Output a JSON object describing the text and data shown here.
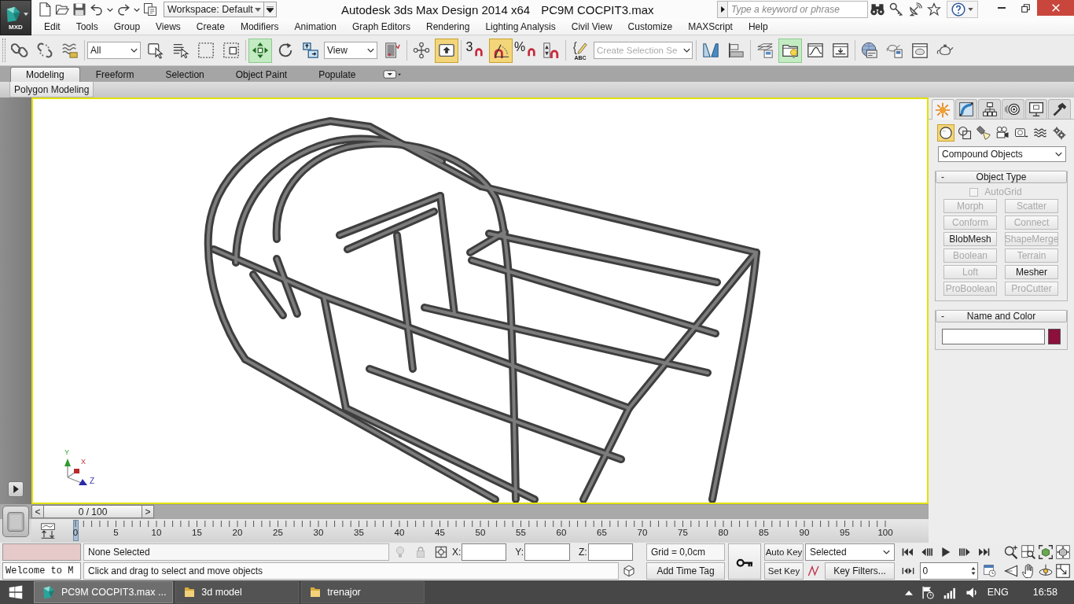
{
  "app_button": {
    "label": "MXD"
  },
  "title_bar": {
    "workspace": "Workspace: Default",
    "title": "Autodesk 3ds Max Design 2014 x64",
    "document": "PC9M COCPIT3.max",
    "search": {
      "placeholder": "Type a keyword or phrase"
    }
  },
  "menu_bar": [
    "Edit",
    "Tools",
    "Group",
    "Views",
    "Create",
    "Modifiers",
    "Animation",
    "Graph Editors",
    "Rendering",
    "Lighting Analysis",
    "Civil View",
    "Customize",
    "MAXScript",
    "Help"
  ],
  "main_toolbar": {
    "groups": [
      [
        {
          "kind": "link",
          "active": false
        },
        {
          "kind": "unlink",
          "active": false
        },
        {
          "kind": "bind",
          "active": false
        }
      ],
      [
        {
          "kind": "dropdown",
          "value": "All"
        },
        {
          "kind": "select",
          "active": false
        },
        {
          "kind": "select-by-name",
          "active": false
        },
        {
          "kind": "region",
          "active": false
        },
        {
          "kind": "crossing",
          "active": false
        }
      ],
      [
        {
          "kind": "move",
          "active": true
        },
        {
          "kind": "rotate",
          "active": false
        },
        {
          "kind": "scale",
          "active": false
        },
        {
          "kind": "dropdown",
          "value": "View"
        },
        {
          "kind": "pivot",
          "active": false
        }
      ],
      [
        {
          "kind": "manipulate",
          "active": false
        },
        {
          "kind": "keyboard",
          "active": true
        }
      ],
      [
        {
          "kind": "snap",
          "label": "3",
          "active": false
        },
        {
          "kind": "angle-snap",
          "active": true
        },
        {
          "kind": "percent-snap",
          "label": "%",
          "active": false
        },
        {
          "kind": "spinner-snap",
          "active": false
        }
      ],
      [
        {
          "kind": "named-selection",
          "label": "ABC",
          "active": false
        },
        {
          "kind": "selection-set",
          "placeholder": "Create Selection Se"
        }
      ],
      [
        {
          "kind": "mirror",
          "active": false
        },
        {
          "kind": "align",
          "active": false
        }
      ],
      [
        {
          "kind": "layers",
          "active": false
        },
        {
          "kind": "scene-explorer",
          "active": true
        },
        {
          "kind": "curve-editor",
          "active": false
        },
        {
          "kind": "schematic",
          "active": false
        }
      ],
      [
        {
          "kind": "material",
          "active": false
        },
        {
          "kind": "render-setup",
          "active": false
        },
        {
          "kind": "frame-window",
          "active": false
        },
        {
          "kind": "render",
          "active": false
        }
      ]
    ]
  },
  "ribbon": {
    "tabs": [
      {
        "label": "Modeling",
        "selected": true
      },
      {
        "label": "Freeform",
        "selected": false
      },
      {
        "label": "Selection",
        "selected": false
      },
      {
        "label": "Object Paint",
        "selected": false
      },
      {
        "label": "Populate",
        "selected": false
      }
    ],
    "panel": "Polygon Modeling"
  },
  "viewport": {
    "axis_labels": [
      "Y",
      "X",
      "Z"
    ]
  },
  "command_panel": {
    "tabs": [
      {
        "kind": "create",
        "selected": true
      },
      {
        "kind": "modify",
        "selected": false
      },
      {
        "kind": "hierarchy",
        "selected": false
      },
      {
        "kind": "motion",
        "selected": false
      },
      {
        "kind": "display",
        "selected": false
      },
      {
        "kind": "utilities",
        "selected": false
      }
    ],
    "categories": [
      {
        "kind": "geometry",
        "selected": true
      },
      {
        "kind": "shapes",
        "selected": false
      },
      {
        "kind": "lights",
        "selected": false
      },
      {
        "kind": "cameras",
        "selected": false
      },
      {
        "kind": "helpers",
        "selected": false
      },
      {
        "kind": "space-warps",
        "selected": false
      },
      {
        "kind": "systems",
        "selected": false
      }
    ],
    "object_class": "Compound Objects",
    "object_type": {
      "toggle": "-",
      "title": "Object Type",
      "autogrid": {
        "label": "AutoGrid",
        "checked": false,
        "disabled": true
      },
      "buttons": [
        {
          "label": "Morph",
          "disabled": true
        },
        {
          "label": "Scatter",
          "disabled": true
        },
        {
          "label": "Conform",
          "disabled": true
        },
        {
          "label": "Connect",
          "disabled": true
        },
        {
          "label": "BlobMesh",
          "disabled": false
        },
        {
          "label": "ShapeMerge",
          "disabled": true
        },
        {
          "label": "Boolean",
          "disabled": true
        },
        {
          "label": "Terrain",
          "disabled": true
        },
        {
          "label": "Loft",
          "disabled": true
        },
        {
          "label": "Mesher",
          "disabled": false
        },
        {
          "label": "ProBoolean",
          "disabled": true
        },
        {
          "label": "ProCutter",
          "disabled": true
        }
      ]
    },
    "name_and_color": {
      "toggle": "-",
      "title": "Name and Color",
      "color": "#8c0f3c"
    }
  },
  "time_slider": {
    "previous": "<",
    "label": "0 / 100",
    "next": ">",
    "level": 0
  },
  "track_bar": {
    "labels": [
      "0",
      "5",
      "10",
      "15",
      "20",
      "25",
      "30",
      "35",
      "40",
      "45",
      "50",
      "55",
      "60",
      "65",
      "70",
      "75",
      "80",
      "85",
      "90",
      "95",
      "100"
    ]
  },
  "status_bar": {
    "listener_output": "Welcome to M",
    "selection": "None Selected",
    "prompt": "Click and drag to select and move objects",
    "coordinates": [
      {
        "label": "X:"
      },
      {
        "label": "Y:"
      },
      {
        "label": "Z:"
      }
    ],
    "grid": "Grid = 0,0cm",
    "time_tag": "Add Time Tag",
    "auto_key": {
      "label": "Auto Key",
      "on": false
    },
    "set_key": "Set Key",
    "key_set": "Selected",
    "key_filters": "Key Filters...",
    "frame": "0"
  },
  "taskbar": {
    "tasks": [
      {
        "kind": "app",
        "label": "PC9M COCPIT3.max ...",
        "selected": true
      },
      {
        "kind": "folder",
        "label": "3d model",
        "selected": false
      },
      {
        "kind": "folder",
        "label": "trenajor",
        "selected": false
      }
    ],
    "language": "ENG",
    "time": "16:58"
  }
}
